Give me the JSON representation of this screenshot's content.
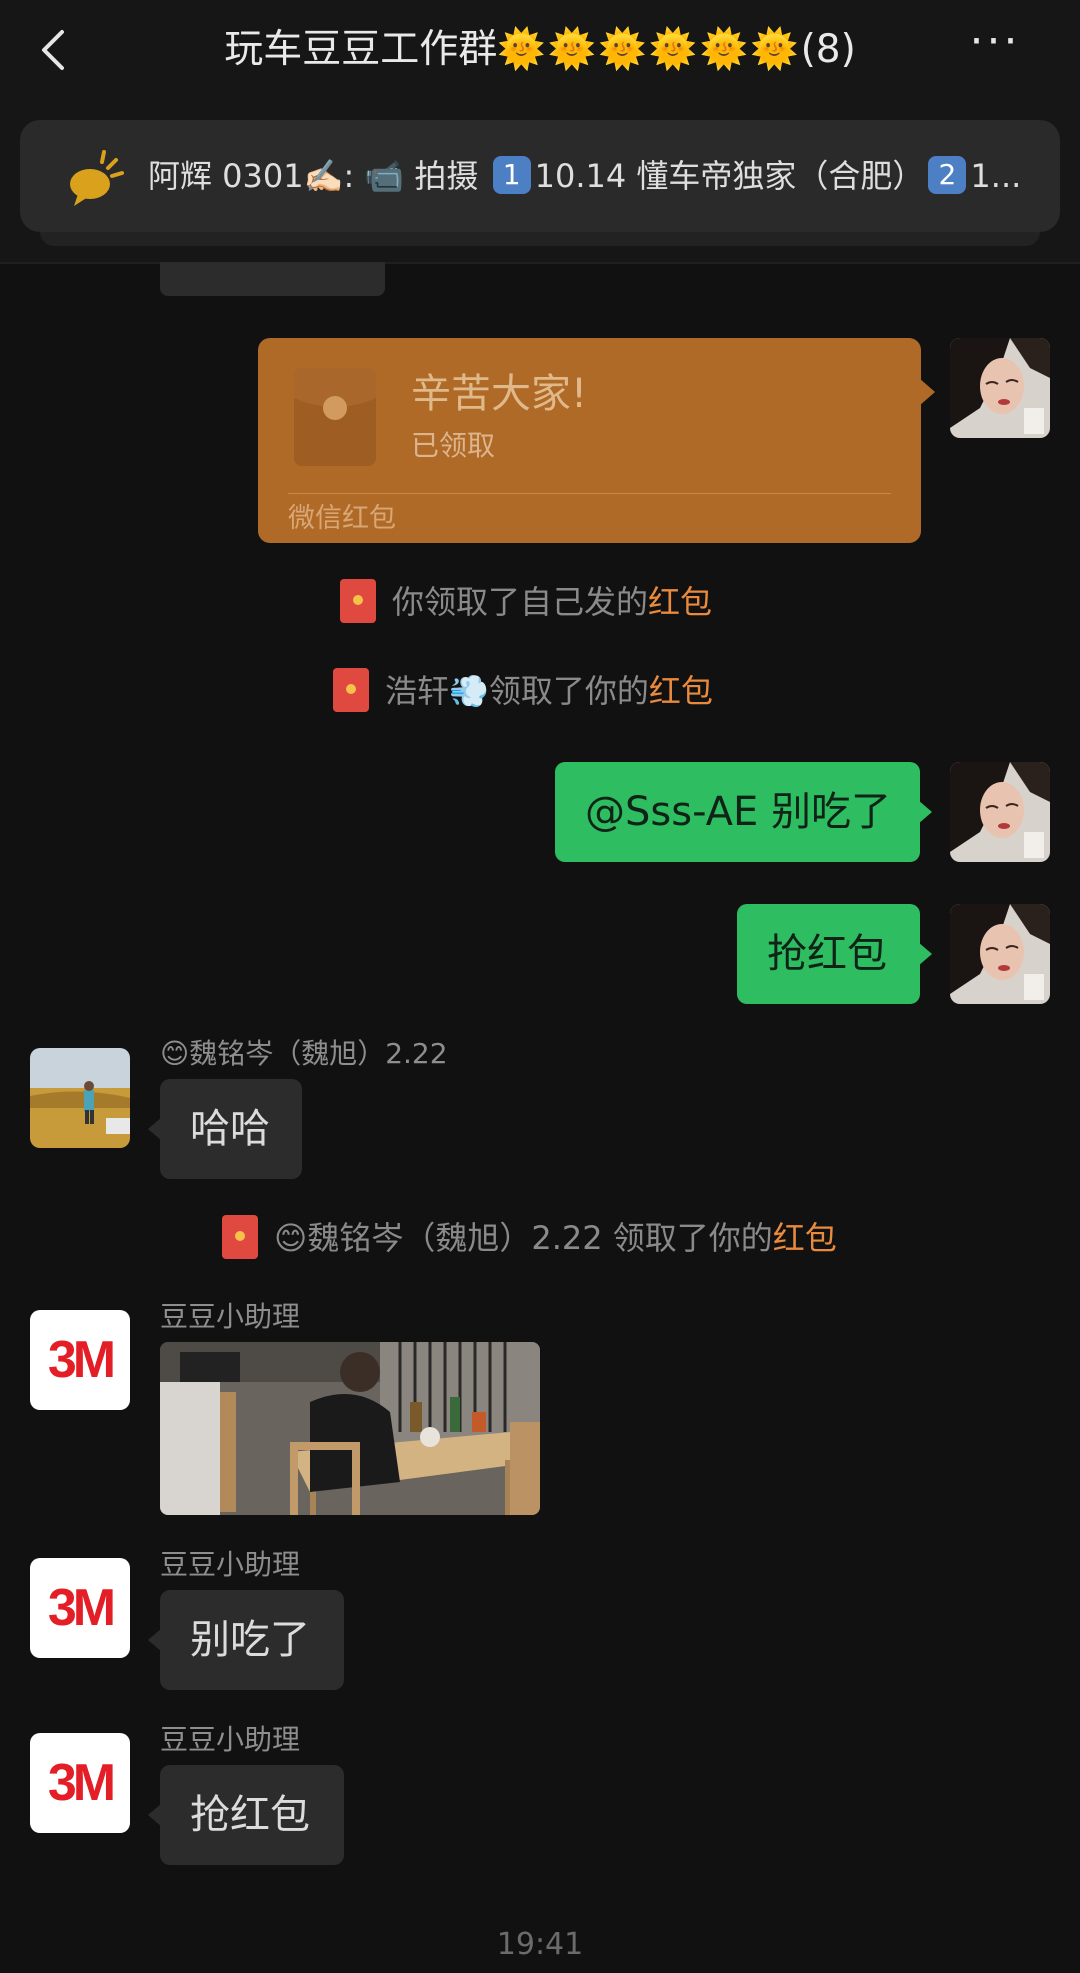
{
  "header": {
    "title_text": "玩车豆豆工作群",
    "title_suns": "🌞🌞🌞🌞🌞🌞",
    "title_count": "(8)",
    "more_label": "···",
    "back_icon": "chevron-left-icon"
  },
  "pinned": {
    "icon": "announcement-icon",
    "parts": [
      "阿辉 0301✍🏻: 📹 拍摄 ",
      "1",
      "10.14 懂车帝独家（合肥）",
      "2",
      "1..."
    ]
  },
  "red_packet": {
    "title": "辛苦大家!",
    "status": "已领取",
    "footer": "微信红包"
  },
  "system_messages": [
    {
      "before": "你领取了自己发的",
      "highlight": "红包"
    },
    {
      "before": "浩轩💨领取了你的",
      "highlight": "红包"
    },
    {
      "before": "😊魏铭岑（魏旭）2.22 领取了你的",
      "highlight": "红包"
    }
  ],
  "messages": {
    "msg1": "@Sss-AE 别吃了",
    "msg2": "抢红包",
    "wei_name": "😊魏铭岑（魏旭）2.22",
    "wei_text": "哈哈",
    "bot_name": "豆豆小助理",
    "bot_text1": "别吃了",
    "bot_text2": "抢红包",
    "bot_logo": "3M"
  },
  "timestamp": "19:41",
  "colors": {
    "background": "#111111",
    "green_bubble": "#2fbd62",
    "gray_bubble": "#2c2c2c",
    "red_packet": "#b06a27",
    "highlight": "#e98a3d"
  }
}
